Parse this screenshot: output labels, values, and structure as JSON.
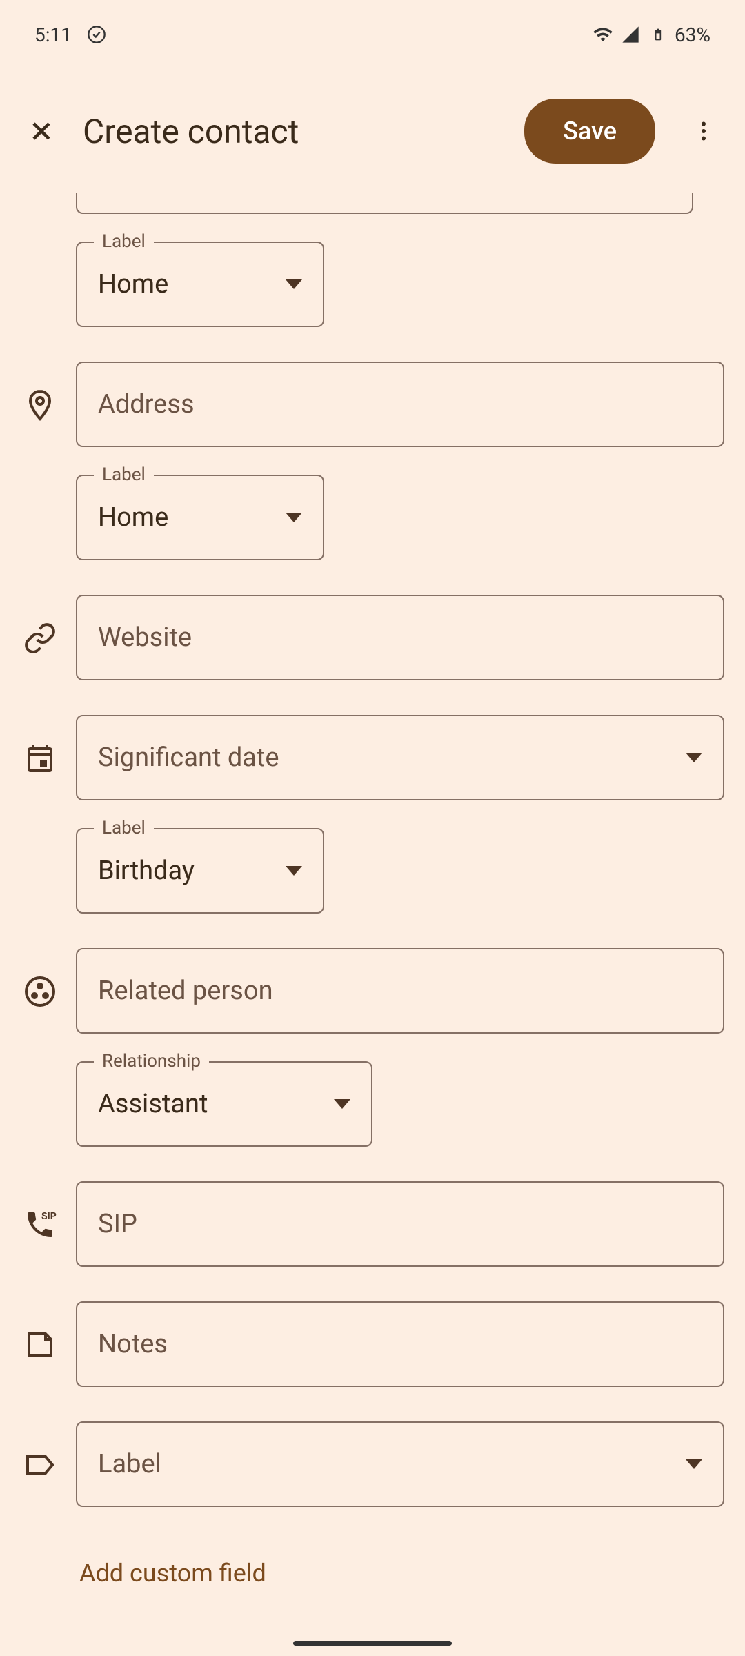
{
  "statusBar": {
    "time": "5:11",
    "battery": "63%"
  },
  "header": {
    "title": "Create contact",
    "saveLabel": "Save"
  },
  "fields": {
    "emailLabel": {
      "legend": "Label",
      "value": "Home"
    },
    "address": {
      "placeholder": "Address",
      "label": {
        "legend": "Label",
        "value": "Home"
      }
    },
    "website": {
      "placeholder": "Website"
    },
    "significantDate": {
      "placeholder": "Significant date",
      "label": {
        "legend": "Label",
        "value": "Birthday"
      }
    },
    "relatedPerson": {
      "placeholder": "Related person",
      "label": {
        "legend": "Relationship",
        "value": "Assistant"
      }
    },
    "sip": {
      "placeholder": "SIP"
    },
    "notes": {
      "placeholder": "Notes"
    },
    "label": {
      "placeholder": "Label"
    }
  },
  "addCustom": "Add custom field"
}
